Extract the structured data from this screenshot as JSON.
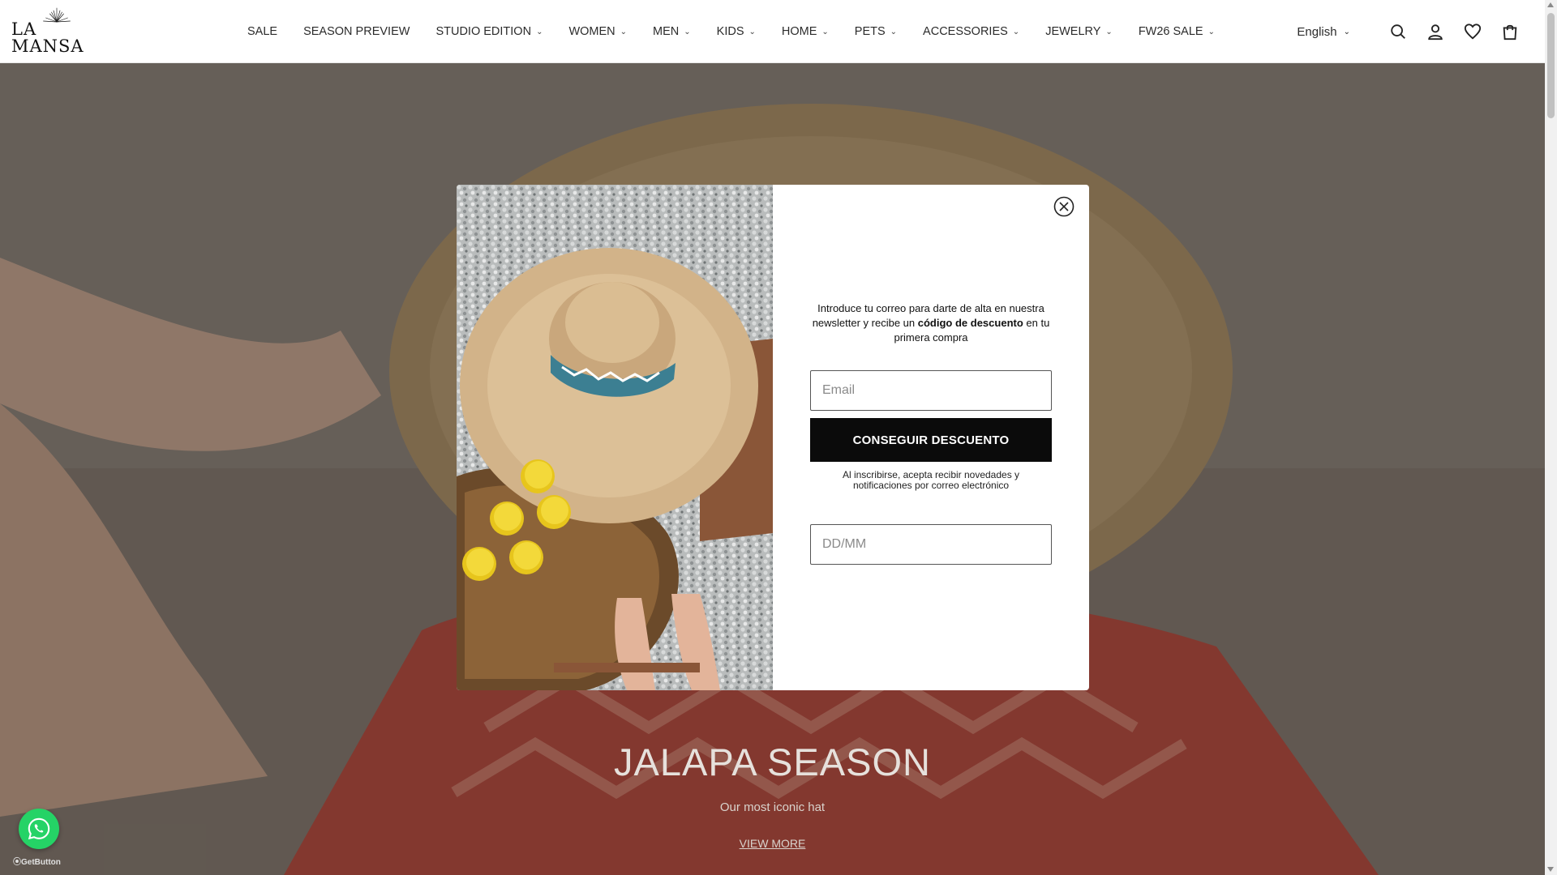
{
  "brand": {
    "logo_text": "LA MANSA"
  },
  "nav": {
    "items": [
      {
        "label": "SALE",
        "dropdown": false
      },
      {
        "label": "SEASON PREVIEW",
        "dropdown": false
      },
      {
        "label": "STUDIO EDITION",
        "dropdown": true
      },
      {
        "label": "WOMEN",
        "dropdown": true
      },
      {
        "label": "MEN",
        "dropdown": true
      },
      {
        "label": "KIDS",
        "dropdown": true
      },
      {
        "label": "HOME",
        "dropdown": true
      },
      {
        "label": "PETS",
        "dropdown": true
      },
      {
        "label": "ACCESSORIES",
        "dropdown": true
      },
      {
        "label": "JEWELRY",
        "dropdown": true
      },
      {
        "label": "FW26 SALE",
        "dropdown": true
      }
    ],
    "chevron": "⌄"
  },
  "header_right": {
    "language": "English",
    "icons": [
      "search-icon",
      "account-icon",
      "wishlist-icon",
      "cart-icon"
    ]
  },
  "hero": {
    "title": "JALAPA SEASON",
    "subtitle": "Our most iconic hat",
    "cta": "VIEW MORE"
  },
  "popup": {
    "intro_before": "Introduce tu correo para darte de alta en nuestra newsletter y recibe un ",
    "intro_bold": "código de descuento",
    "intro_after": " en tu primera compra",
    "email_placeholder": "Email",
    "button_label": "CONSEGUIR DESCUENTO",
    "legal": "Al inscribirse, acepta recibir novedades y notificaciones por correo electrónico",
    "dob_placeholder": "DD/MM",
    "close_icon": "close-icon"
  },
  "widget": {
    "whatsapp_icon": "whatsapp-icon",
    "getbutton_label": "GetButton"
  },
  "colors": {
    "cta_bg": "#0b0b0b",
    "whatsapp": "#25d366",
    "overlay": "rgba(40,36,33,0.42)"
  }
}
